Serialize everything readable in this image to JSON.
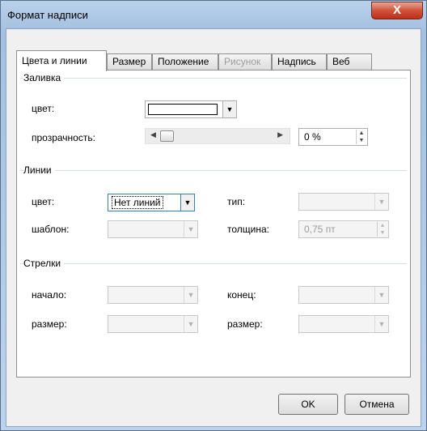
{
  "window": {
    "title": "Формат надписи",
    "close_glyph": "X"
  },
  "tabs": [
    {
      "label": "Цвета и линии",
      "state": "active"
    },
    {
      "label": "Размер",
      "state": "normal"
    },
    {
      "label": "Положение",
      "state": "normal"
    },
    {
      "label": "Рисунок",
      "state": "disabled"
    },
    {
      "label": "Надпись",
      "state": "normal"
    },
    {
      "label": "Веб",
      "state": "normal"
    }
  ],
  "fill": {
    "group": "Заливка",
    "color_label": "цвет:",
    "color_value": "#ffffff",
    "transparency_label": "прозрачность:",
    "transparency_value": "0 %",
    "transparency_level": 0
  },
  "lines": {
    "group": "Линии",
    "color_label": "цвет:",
    "color_value": "Нет линий",
    "type_label": "тип:",
    "pattern_label": "шаблон:",
    "weight_label": "толщина:",
    "weight_value": "0,75 пт"
  },
  "arrows": {
    "group": "Стрелки",
    "begin_label": "начало:",
    "end_label": "конец:",
    "size_label_left": "размер:",
    "size_label_right": "размер:"
  },
  "buttons": {
    "ok": "OK",
    "cancel": "Отмена"
  },
  "icons": {
    "dropdown": "dropdown-arrow-icon",
    "close": "close-icon",
    "spin": "spin-arrows-icon"
  }
}
